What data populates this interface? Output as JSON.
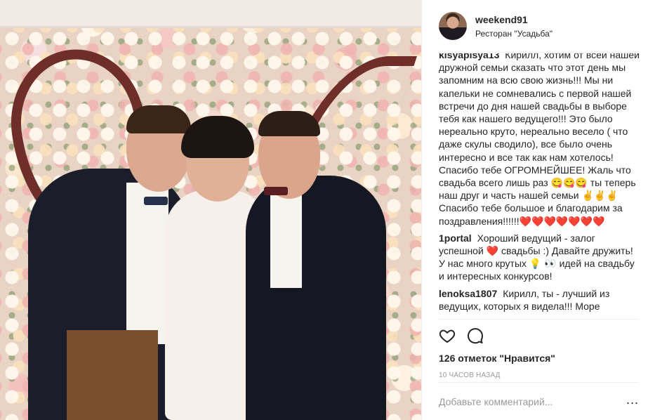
{
  "post": {
    "username": "weekend91",
    "location": "Ресторан \"Усадьба\""
  },
  "comments": [
    {
      "author": "kisyapisya13",
      "text": "Кирилл, хотим от всей нашей дружной семьи сказать что этот день мы запомним на всю свою жизнь!!! Мы ни капельки не сомневались с первой нашей встречи до дня нашей свадьбы в выборе тебя как нашего ведущего!!! Это было нереально круто, нереально весело ( что даже скулы сводило), все было очень интересно и все так как нам хотелось! Спасибо тебе ОГРОМНЕЙШЕЕ! Жаль что свадьба всего лишь раз 😋😋😋 ты теперь наш друг и часть нашей семьи ✌✌✌ Спасибо тебе большое и благодарим за поздравления!!!!!!❤️❤️❤️❤️❤️❤️❤️"
    },
    {
      "author": "1portal",
      "text": "Хороший ведущий - залог успешной ❤️ свадьбы :) Давайте дружить! У нас много крутых 💡 👀 идей на свадьбу и интересных конкурсов!"
    },
    {
      "author": "lenoksa1807",
      "text": "Кирилл, ты - лучший из ведущих, которых я видела!!! Море"
    }
  ],
  "actions": {
    "like_icon": "heart-outline-icon",
    "comment_icon": "speech-bubble-icon"
  },
  "likes_text": "126 отметок \"Нравится\"",
  "timestamp": "10 ЧАСОВ НАЗАД",
  "add_comment": {
    "placeholder": "Добавьте комментарий...",
    "more_label": "..."
  },
  "colors": {
    "text": "#262626",
    "muted": "#999999",
    "divider": "#efefef"
  }
}
